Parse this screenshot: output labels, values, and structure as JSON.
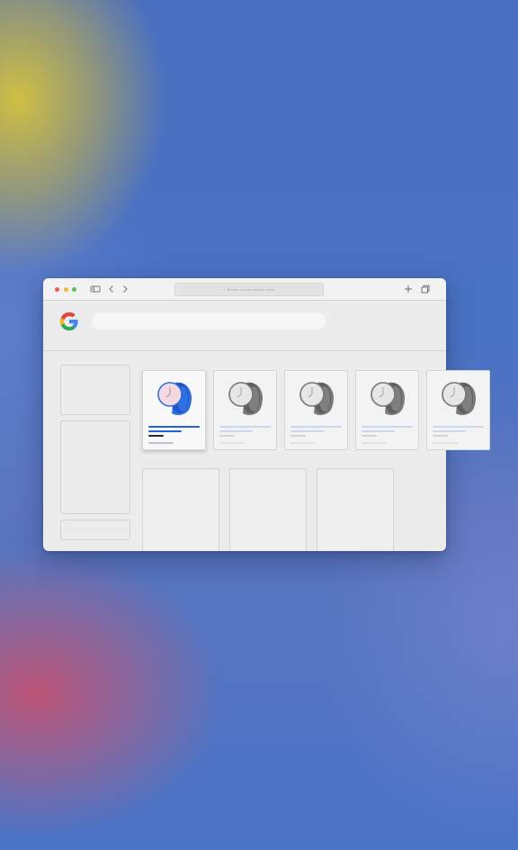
{
  "browser": {
    "address_placeholder": "Search or enter website name",
    "icons": [
      "sidebar-icon",
      "back-arrow-icon",
      "forward-arrow-icon",
      "new-tab-icon",
      "tabs-overview-icon"
    ]
  },
  "logo": "Google G logo",
  "products": [
    {
      "watch": "blue-watch",
      "selected": true
    },
    {
      "watch": "gray-watch",
      "selected": false
    },
    {
      "watch": "gray-watch",
      "selected": false
    },
    {
      "watch": "gray-watch",
      "selected": false
    },
    {
      "watch": "gray-watch",
      "selected": false
    }
  ],
  "colors": {
    "accent_blue": "#1f63d6",
    "watch_blue": "#2f6fe0",
    "watch_face_pink": "#f6d9e0",
    "placeholder_bar": "#c9d8ee"
  }
}
